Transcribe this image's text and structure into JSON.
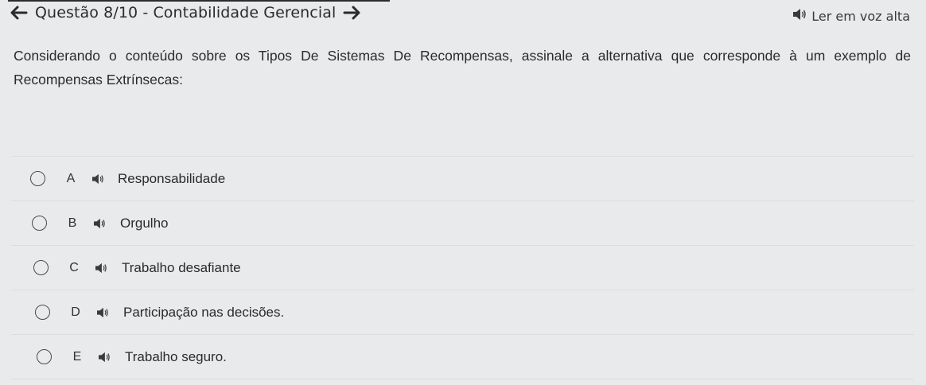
{
  "header": {
    "back_icon": "arrow-left-icon",
    "title": "Questão 8/10 - Contabilidade Gerencial",
    "forward_icon": "arrow-right-icon"
  },
  "read_aloud": {
    "icon": "speaker-icon",
    "label": "Ler em voz alta"
  },
  "question": {
    "text": "Considerando o conteúdo sobre os Tipos De Sistemas De Recompensas, assinale a alternativa que corresponde à um exemplo de Recompensas Extrínsecas:"
  },
  "options": [
    {
      "letter": "A",
      "text": "Responsabilidade"
    },
    {
      "letter": "B",
      "text": "Orgulho"
    },
    {
      "letter": "C",
      "text": "Trabalho desafiante"
    },
    {
      "letter": "D",
      "text": "Participação nas decisões."
    },
    {
      "letter": "E",
      "text": "Trabalho seguro."
    }
  ],
  "colors": {
    "background": "#e9eaec",
    "text": "#2b2b2b",
    "divider": "#dcdde0"
  }
}
